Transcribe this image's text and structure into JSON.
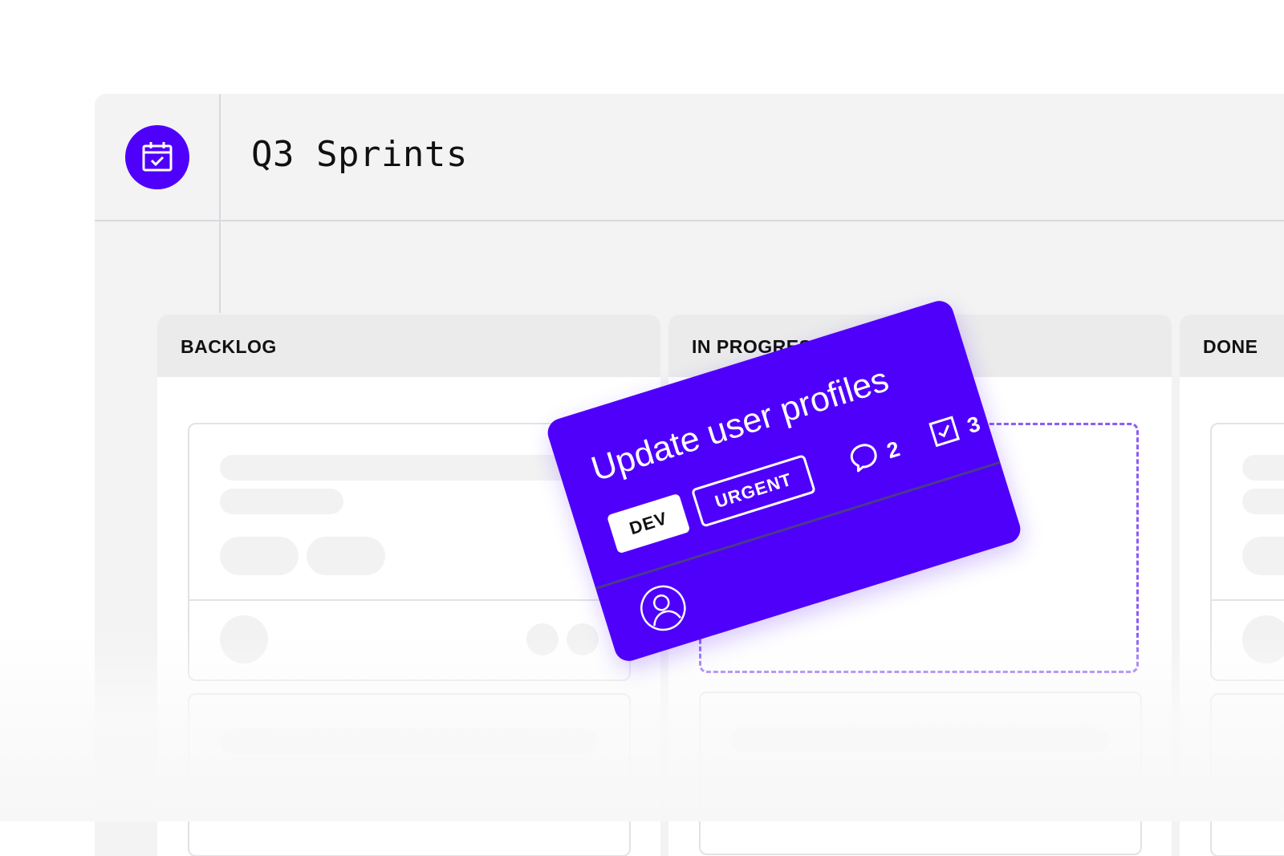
{
  "header": {
    "title": "Q3 Sprints",
    "logo_icon": "calendar-check-icon"
  },
  "columns": [
    {
      "label": "BACKLOG"
    },
    {
      "label": "IN PROGRESS"
    },
    {
      "label": "DONE"
    }
  ],
  "dragged_card": {
    "title": "Update user profiles",
    "tags": [
      "DEV",
      "URGENT"
    ],
    "comments_count": "2",
    "checklist_count": "3",
    "icons": {
      "comments": "comment-icon",
      "checklist": "checkbox-icon",
      "assignee": "user-avatar-icon"
    }
  },
  "colors": {
    "accent": "#4f00fb",
    "drop_zone": "#8b5cf6",
    "background": "#f3f3f3"
  }
}
